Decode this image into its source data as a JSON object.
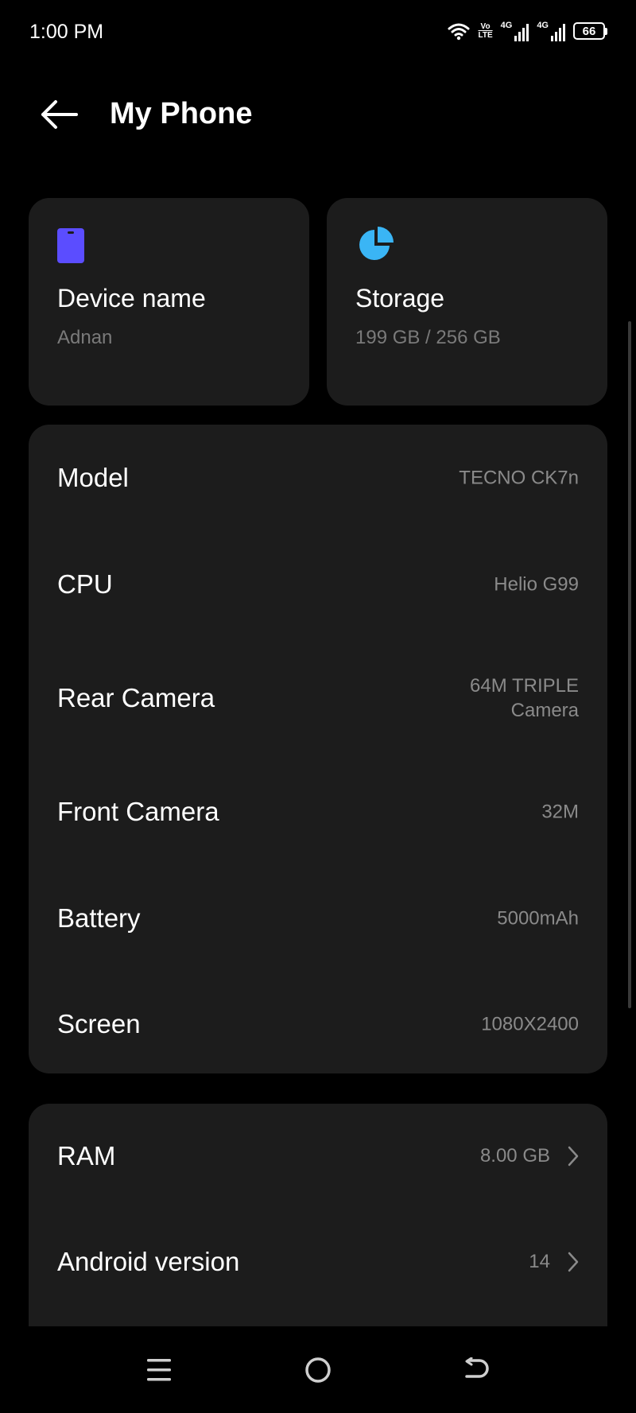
{
  "status_bar": {
    "time": "1:00 PM",
    "volte_top": "Vo",
    "volte_bottom": "LTE",
    "network_1": "4G",
    "network_2": "4G",
    "battery": "66"
  },
  "header": {
    "title": "My Phone"
  },
  "tiles": {
    "device": {
      "title": "Device name",
      "value": "Adnan",
      "icon": "phone-icon",
      "icon_color": "#5b4dff"
    },
    "storage": {
      "title": "Storage",
      "value": "199 GB / 256 GB",
      "icon": "pie-chart-icon",
      "icon_color": "#3ab5f5"
    }
  },
  "specs": [
    {
      "label": "Model",
      "value": "TECNO CK7n"
    },
    {
      "label": "CPU",
      "value": "Helio G99"
    },
    {
      "label": "Rear Camera",
      "value": "64M TRIPLE Camera"
    },
    {
      "label": "Front Camera",
      "value": "32M"
    },
    {
      "label": "Battery",
      "value": "5000mAh"
    },
    {
      "label": "Screen",
      "value": "1080X2400"
    }
  ],
  "system": [
    {
      "label": "RAM",
      "value": "8.00 GB"
    },
    {
      "label": "Android version",
      "value": "14"
    }
  ],
  "colors": {
    "background": "#000000",
    "card": "#1c1c1c",
    "secondary_text": "#8a8a8a"
  }
}
